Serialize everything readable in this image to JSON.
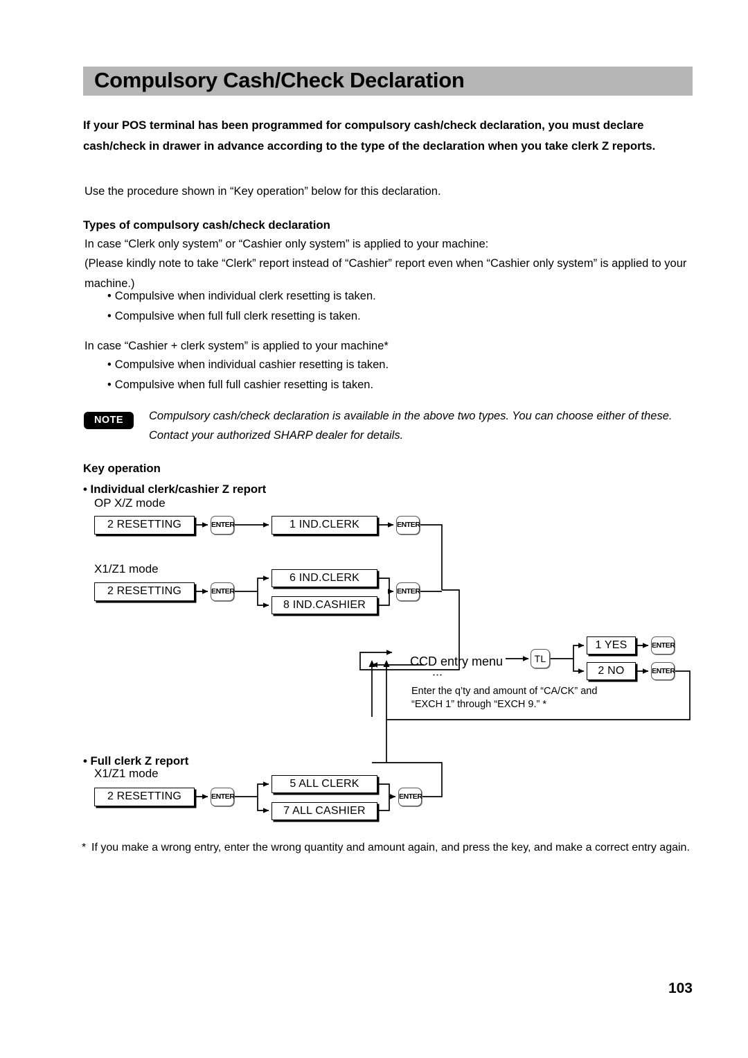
{
  "page": {
    "title": "Compulsory Cash/Check Declaration",
    "number": "103",
    "header_bg": "#b5b5b5"
  },
  "intro": {
    "paragraph": "If your POS terminal has been programmed for compulsory cash/check declaration, you must declare cash/check in drawer in advance according to the type of the declaration when you take clerk Z reports.",
    "use_procedure": "Use the procedure shown in “Key operation” below for this declaration."
  },
  "types_section": {
    "heading": "Types of compulsory cash/check declaration",
    "case_one": "In case “Clerk only system” or “Cashier only system” is applied to your machine:",
    "please_note": "(Please kindly note to take “Clerk” report instead of “Cashier” report even when “Cashier only system” is applied to your machine.)",
    "bullets_one": [
      "Compulsive when individual clerk resetting is taken.",
      "Compulsive when full full clerk resetting is taken."
    ],
    "case_two": "In case  “Cashier + clerk system” is applied to your machine*",
    "bullets_two": [
      "Compulsive when individual cashier resetting is taken.",
      "Compulsive when full full cashier resetting is taken."
    ]
  },
  "note": {
    "badge": "NOTE",
    "text": "Compulsory cash/check declaration is available in the above two types. You can choose either of these. Contact your authorized SHARP dealer for details."
  },
  "key_operation": {
    "heading": "Key operation",
    "individual_heading": "• Individual clerk/cashier Z report",
    "full_heading": "• Full clerk Z report",
    "mode_op_xz": "OP X/Z mode",
    "mode_x1z1_individual": "X1/Z1 mode",
    "mode_x1z1_full": "X1/Z1 mode"
  },
  "flow": {
    "op_xz_row": {
      "resetting": "2  RESETTING",
      "enter_1": "ENTER",
      "ind_clerk": "1   IND.CLERK",
      "enter_2": "ENTER"
    },
    "x1z1_individual_row": {
      "resetting": "2  RESETTING",
      "enter_1": "ENTER",
      "ind_clerk": "6  IND.CLERK",
      "ind_cashier": "8  IND.CASHIER",
      "enter_2": "ENTER"
    },
    "ccd": {
      "menu_label": "CCD entry menu",
      "dots": "⋮",
      "tl_key": "TL",
      "instruction": "Enter the q’ty and amount of “CA/CK” and “EXCH 1” through “EXCH 9.” *",
      "yes_option": "1 YES",
      "no_option": "2 NO",
      "enter_yes": "ENTER",
      "enter_no": "ENTER"
    },
    "x1z1_full_row": {
      "resetting": "2  RESETTING",
      "enter_1": "ENTER",
      "all_clerk": "5 ALL  CLERK",
      "all_cashier": "7 ALL  CASHIER",
      "enter_2": "ENTER"
    }
  },
  "footnote": {
    "marker": "*",
    "text": "If you make a wrong entry, enter the wrong quantity and amount again, and press the  key, and make a correct entry again."
  }
}
